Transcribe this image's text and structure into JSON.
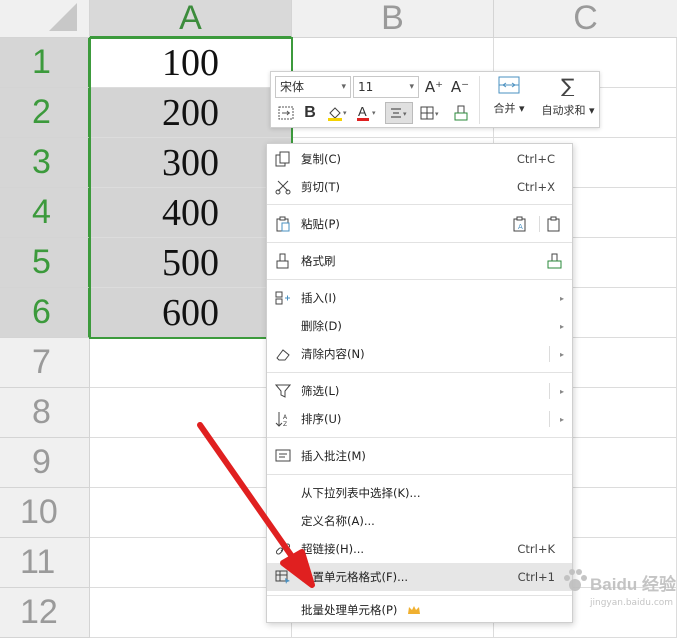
{
  "sheet": {
    "columns": [
      "A",
      "B",
      "C"
    ],
    "rows": [
      "1",
      "2",
      "3",
      "4",
      "5",
      "6",
      "7",
      "8",
      "9",
      "10",
      "11",
      "12"
    ],
    "values": [
      "100",
      "200",
      "300",
      "400",
      "500",
      "600"
    ],
    "selection_color": "#3c9a3c"
  },
  "toolbar": {
    "font_name": "宋体",
    "font_size": "11",
    "increase_font_icon": "A⁺",
    "decrease_font_icon": "A⁻",
    "bold": "B",
    "font_color_glyph": "A",
    "merge_label": "合并",
    "autosum_label": "自动求和"
  },
  "menu": {
    "copy": {
      "label": "复制(C)",
      "shortcut": "Ctrl+C"
    },
    "cut": {
      "label": "剪切(T)",
      "shortcut": "Ctrl+X"
    },
    "paste": {
      "label": "粘贴(P)"
    },
    "format_painter": {
      "label": "格式刷"
    },
    "insert": {
      "label": "插入(I)"
    },
    "delete": {
      "label": "删除(D)"
    },
    "clear": {
      "label": "清除内容(N)"
    },
    "filter": {
      "label": "筛选(L)"
    },
    "sort": {
      "label": "排序(U)"
    },
    "comment": {
      "label": "插入批注(M)"
    },
    "dropdown_pick": {
      "label": "从下拉列表中选择(K)..."
    },
    "define_name": {
      "label": "定义名称(A)..."
    },
    "hyperlink": {
      "label": "超链接(H)...",
      "shortcut": "Ctrl+K"
    },
    "format_cells": {
      "label": "设置单元格格式(F)...",
      "shortcut": "Ctrl+1"
    },
    "batch": {
      "label": "批量处理单元格(P)"
    }
  },
  "watermark": {
    "text": "Baidu 经验",
    "sub": "jingyan.baidu.com"
  },
  "colors": {
    "accent_green": "#3c9a3c",
    "arrow_red": "#e02020",
    "crown": "#f0b030"
  }
}
